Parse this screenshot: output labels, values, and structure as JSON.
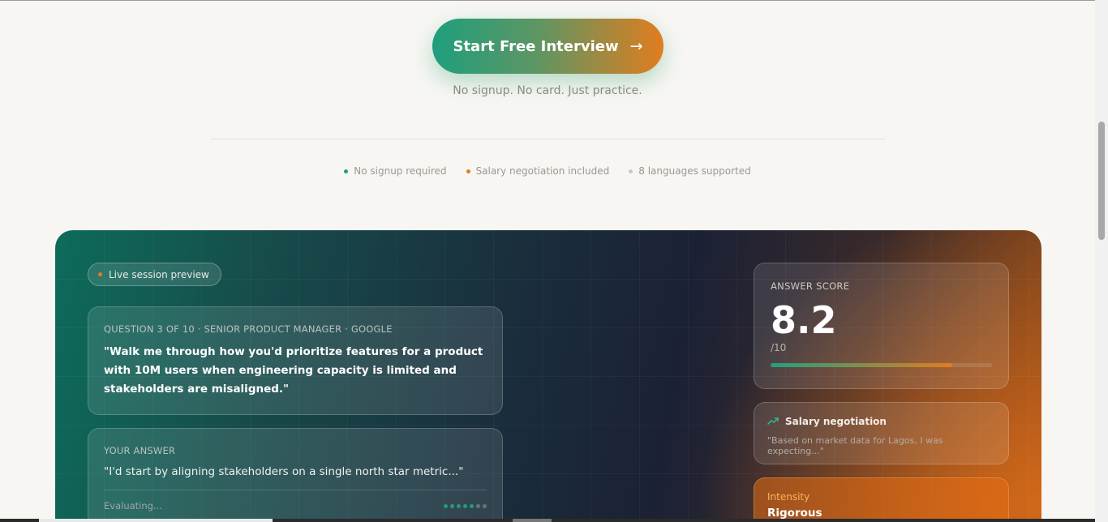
{
  "hero": {
    "cta_label": "Start Free Interview",
    "cta_arrow": "→",
    "subtext": "No signup. No card. Just practice."
  },
  "features": [
    {
      "label": "No signup required",
      "dot_color": "#1f9e7d"
    },
    {
      "label": "Salary negotiation included",
      "dot_color": "#e07d1e"
    },
    {
      "label": "8 languages supported",
      "dot_color": "#c9c7c2"
    }
  ],
  "preview": {
    "badge": "Live session preview",
    "question": {
      "eyebrow": "QUESTION 3 OF 10 · SENIOR PRODUCT MANAGER · GOOGLE",
      "text": "\"Walk me through how you'd prioritize features for a product with 10M users when engineering capacity is limited and stakeholders are misaligned.\""
    },
    "answer": {
      "eyebrow": "YOUR ANSWER",
      "text": "\"I'd start by aligning stakeholders on a single north star metric...\"",
      "status": "Evaluating...",
      "progress_dots": {
        "active": 5,
        "total": 7
      }
    },
    "score": {
      "label": "ANSWER SCORE",
      "value": "8.2",
      "suffix": "/10",
      "fraction": 0.82
    },
    "negotiation": {
      "title": "Salary negotiation",
      "icon": "trend-up-icon",
      "quote": "\"Based on market data for Lagos, I was expecting...\""
    },
    "intensity": {
      "label": "Intensity",
      "value": "Rigorous"
    }
  },
  "colors": {
    "accent_green": "#1f9e7d",
    "accent_orange": "#e07d1e"
  }
}
